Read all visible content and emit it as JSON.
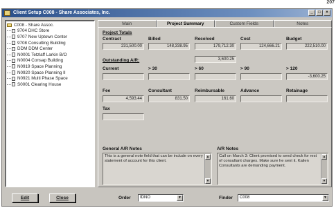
{
  "corner_text": "207",
  "window": {
    "title": "Client Setup   C008 - Share Associates, Inc."
  },
  "tree": {
    "items": [
      {
        "label": "C008 - Share Assoc.",
        "root": true
      },
      {
        "label": "9704  DHC Store"
      },
      {
        "label": "9707  New Uptown Center"
      },
      {
        "label": "9708  Consulting Building"
      },
      {
        "label": "DDM  DDM Center"
      },
      {
        "label": "N0001  Tetzlaff Larkin B/O"
      },
      {
        "label": "N0004  Consap Building"
      },
      {
        "label": "N0919  Space Planning"
      },
      {
        "label": "N0920  Space Planning II"
      },
      {
        "label": "N0921  Multi Phase Space"
      },
      {
        "label": "S0001  Clearing House"
      }
    ]
  },
  "tabs": [
    "Main",
    "Project Summary",
    "Custom Fields",
    "Notes"
  ],
  "project_totals": {
    "heading": "Project Totals",
    "contract_label": "Contract",
    "contract": "231,500.00",
    "billed_label": "Billed",
    "billed": "148,338.95",
    "received_label": "Received",
    "received": "179,712.30",
    "cost_label": "Cost",
    "cost": "124,666.21",
    "budget_label": "Budget",
    "budget": "222,510.00"
  },
  "outstanding": {
    "heading": "Outstanding A/R:",
    "total": "3,600.25",
    "current_label": "Current",
    "current": "",
    "gt30_label": "> 30",
    "gt30": "",
    "gt60_label": "> 60",
    "gt60": "",
    "gt90_label": "> 90",
    "gt90": "",
    "gt120_label": "> 120",
    "gt120": "-3,600.25"
  },
  "fees": {
    "fee_label": "Fee",
    "fee": "4,593.44",
    "consultant_label": "Consultant",
    "consultant": "831.50",
    "reimbursable_label": "Reimbursable",
    "reimbursable": "161.60",
    "advance_label": "Advance",
    "advance": "",
    "retainage_label": "Retainage",
    "retainage": "",
    "tax_label": "Tax",
    "tax": ""
  },
  "general_notes": {
    "heading": "General A/R Notes",
    "text": "This is a general note field that can be include on every statement of account for this client."
  },
  "ar_notes": {
    "heading": "A/R Notes",
    "text": "Call on March 3:  Client promised to send check for rest of consultant charges. Make sure he sent it.  Kailen Consultants are demanding payment."
  },
  "bottom": {
    "edit_label": "Edit",
    "close_label": "Close",
    "order_label": "Order",
    "order_value": "IDNO",
    "finder_label": "Finder",
    "finder_value": "C008"
  }
}
